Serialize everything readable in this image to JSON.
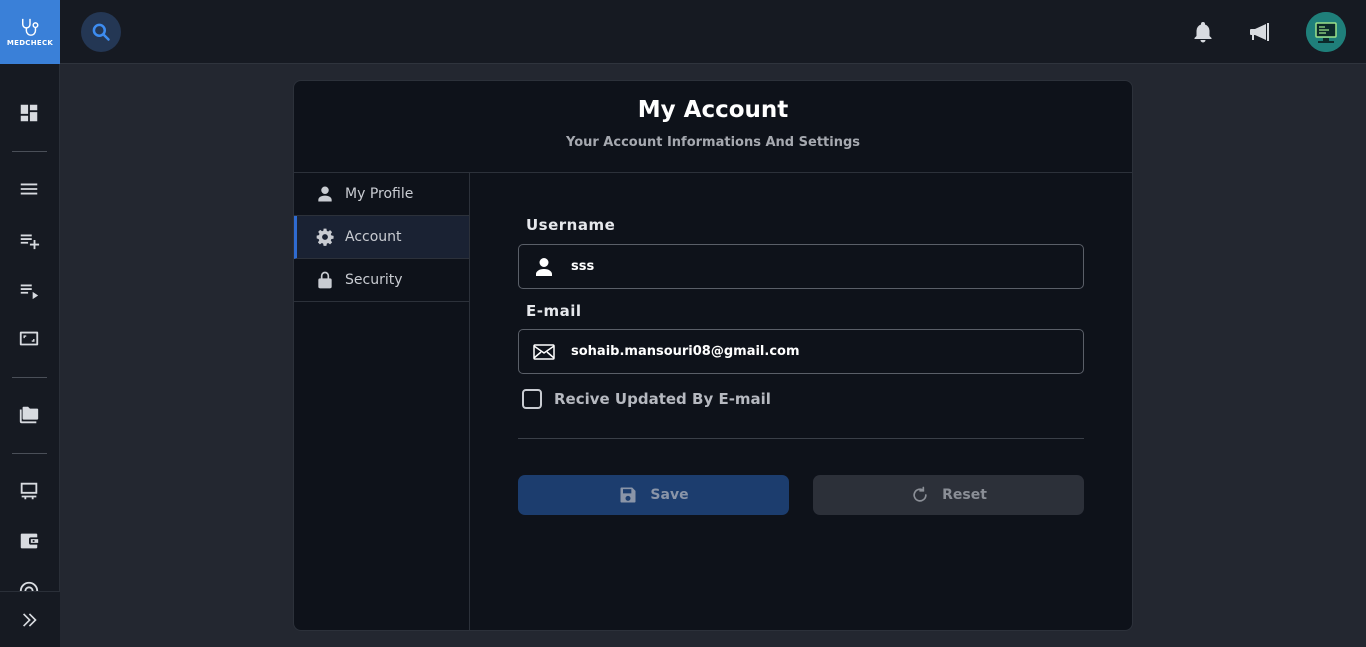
{
  "app": {
    "logo_text": "MEDCHECK"
  },
  "sidebar": {
    "icons": [
      "dashboard-icon",
      "menu-icon",
      "playlist-add-icon",
      "playlist-play-icon",
      "screen-icon",
      "folders-icon",
      "desk-icon",
      "wallet-icon",
      "target-icon"
    ],
    "expand_icon": "double-chevron-right-icon"
  },
  "topbar": {
    "search_icon": "search-icon",
    "notification_icon": "bell-icon",
    "announcement_icon": "megaphone-icon"
  },
  "card": {
    "title": "My Account",
    "subtitle": "Your Account Informations And Settings"
  },
  "tabs": [
    {
      "label": "My Profile",
      "icon": "person-icon",
      "active": false
    },
    {
      "label": "Account",
      "icon": "gear-icon",
      "active": true
    },
    {
      "label": "Security",
      "icon": "lock-icon",
      "active": false
    }
  ],
  "form": {
    "username_label": "Username",
    "username_value": "sss",
    "email_label": "E-mail",
    "email_value": "sohaib.mansouri08@gmail.com",
    "checkbox_label": "Recive Updated By E-mail",
    "checkbox_checked": false,
    "save_label": "Save",
    "reset_label": "Reset"
  },
  "colors": {
    "accent": "#3a80d8",
    "background": "#232730",
    "surface": "#0e121a",
    "save_button": "#1c3d6e",
    "reset_button": "#2c3039"
  }
}
